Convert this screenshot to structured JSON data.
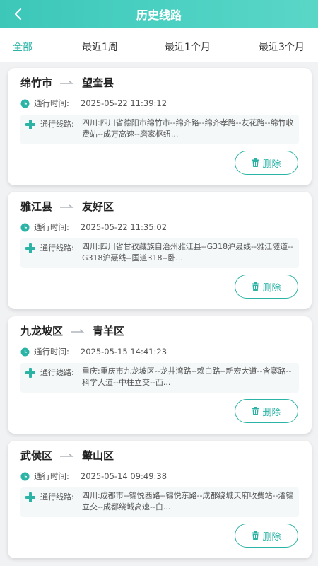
{
  "header": {
    "title": "历史线路",
    "back_icon": "chevron-left-icon"
  },
  "filters": {
    "tabs": [
      {
        "label": "全部",
        "active": true
      },
      {
        "label": "最近1周",
        "active": false
      },
      {
        "label": "最近1个月",
        "active": false
      },
      {
        "label": "最近3个月",
        "active": false
      }
    ]
  },
  "common": {
    "time_label": "通行时间:",
    "route_label": "通行线路:",
    "delete_label": "删除"
  },
  "colors": {
    "accent": "#2bb3a6",
    "header_start": "#3cc7b9",
    "header_end": "#5ad6c7"
  },
  "records": [
    {
      "from": "绵竹市",
      "to": "望奎县",
      "time": "2025-05-22 11:39:12",
      "route": "四川:四川省德阳市绵竹市--绵齐路--绵齐孝路--友花路--绵竹收费站--成万高速--磨家枢纽..."
    },
    {
      "from": "雅江县",
      "to": "友好区",
      "time": "2025-05-22 11:35:02",
      "route": "四川:四川省甘孜藏族自治州雅江县--G318沪聂线--雅江隧道--G318沪聂线--国道318--卧..."
    },
    {
      "from": "九龙坡区",
      "to": "青羊区",
      "time": "2025-05-15 14:41:23",
      "route": "重庆:重庆市九龙坡区--龙井湾路--赖白路--新宏大道--含寨路--科学大道--中柱立交--西..."
    },
    {
      "from": "武侯区",
      "to": "鼙山区",
      "time": "2025-05-14 09:49:38",
      "route": "四川:成都市--锦悦西路--锦悦东路--成都绕城天府收费站--濯锦立交--成都绕城高速--白..."
    }
  ]
}
